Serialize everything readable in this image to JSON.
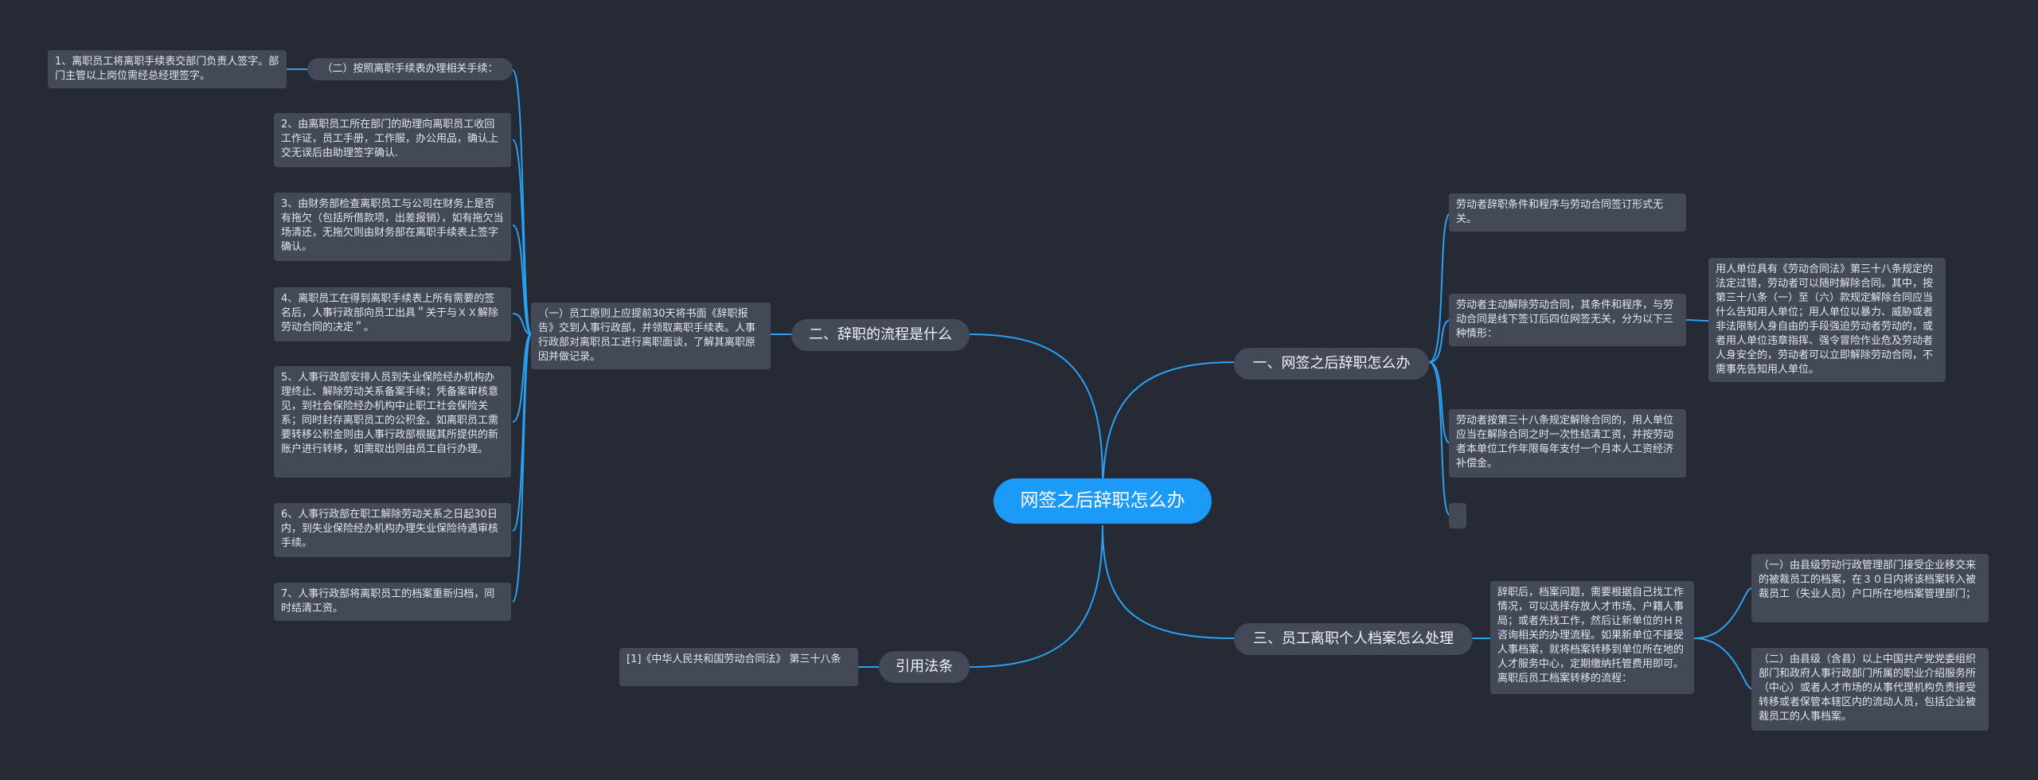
{
  "central": {
    "label": "网签之后辞职怎么办"
  },
  "branches": {
    "b1": "一、网签之后辞职怎么办",
    "b2": "二、辞职的流程是什么",
    "b3": "三、员工离职个人档案怎么处理",
    "b4": "引用法条"
  },
  "topics": {
    "t1_1": "劳动者辞职条件和程序与劳动合同签订形式无关。",
    "t1_2": "劳动者主动解除劳动合同，其条件和程序，与劳动合同是线下签订后四位网签无关，分为以下三种情形：",
    "t1_2a": "用人单位具有《劳动合同法》第三十八条规定的法定过错，劳动者可以随时解除合同。其中，按第三十八条（一）至（六）款规定解除合同应当什么告知用人单位；用人单位以暴力、威胁或者非法限制人身自由的手段强迫劳动者劳动的，或者用人单位违章指挥、强令冒险作业危及劳动者人身安全的，劳动者可以立即解除劳动合同，不需事先告知用人单位。",
    "t1_3": "劳动者按第三十八条规定解除合同的，用人单位应当在解除合同之时一次性结清工资，并按劳动者本单位工作年限每年支付一个月本人工资经济补偿金。",
    "t1_4": "",
    "t2_1": "（一）员工原则上应提前30天将书面《辞职报告》交到人事行政部，并领取离职手续表。人事行政部对离职员工进行离职面谈，了解其离职原因并做记录。",
    "t2_2": "（二）按照离职手续表办理相关手续：",
    "t2_2a": "1、离职员工将离职手续表交部门负责人签字。部门主管以上岗位需经总经理签字。",
    "t2_3": "2、由离职员工所在部门的助理向离职员工收回工作证，员工手册，工作服，办公用品，确认上交无误后由助理签字确认.",
    "t2_4": "3、由财务部检查离职员工与公司在财务上是否有拖欠（包括所借款项，出差报销），如有拖欠当场清还，无拖欠则由财务部在离职手续表上签字确认。",
    "t2_5": "4、离职员工在得到离职手续表上所有需要的签名后，人事行政部向员工出具＂关于与ＸＸ解除劳动合同的决定＂。",
    "t2_6": "5、人事行政部安排人员到失业保险经办机构办理终止、解除劳动关系备案手续；凭备案审核意见，到社会保险经办机构中止职工社会保险关系；同时封存离职员工的公积金。如离职员工需要转移公积金则由人事行政部根据其所提供的新账户进行转移，如需取出则由员工自行办理。",
    "t2_7": "6、人事行政部在职工解除劳动关系之日起30日内，到失业保险经办机构办理失业保险待遇审核手续。",
    "t2_8": "7、人事行政部将离职员工的档案重新归档，同时结清工资。",
    "t3_1": "辞职后，档案问题，需要根据自己找工作情况，可以选择存放人才市场、户籍人事局；或者先找工作，然后让新单位的ＨＲ咨询相关的办理流程。如果新单位不接受人事档案，就将档案转移到单位所在地的人才服务中心，定期缴纳托管费用即可。离职后员工档案转移的流程：",
    "t3_1a": "（一）由县级劳动行政管理部门接受企业移交来的被裁员工的档案，在３０日内将该档案转入被裁员工（失业人员）户口所在地档案管理部门；",
    "t3_1b": "（二）由县级（含县）以上中国共产党党委组织部门和政府人事行政部门所属的职业介绍服务所（中心）或者人才市场的从事代理机构负责接受转移或者保管本辖区内的流动人员，包括企业被裁员工的人事档案。",
    "t4_1": "[1]《中华人民共和国劳动合同法》 第三十八条"
  },
  "colors": {
    "background": "#262a35",
    "accent": "#1b9af7",
    "link": "#2aa1f3",
    "node": "#434957",
    "text": "#e3e6ee"
  }
}
